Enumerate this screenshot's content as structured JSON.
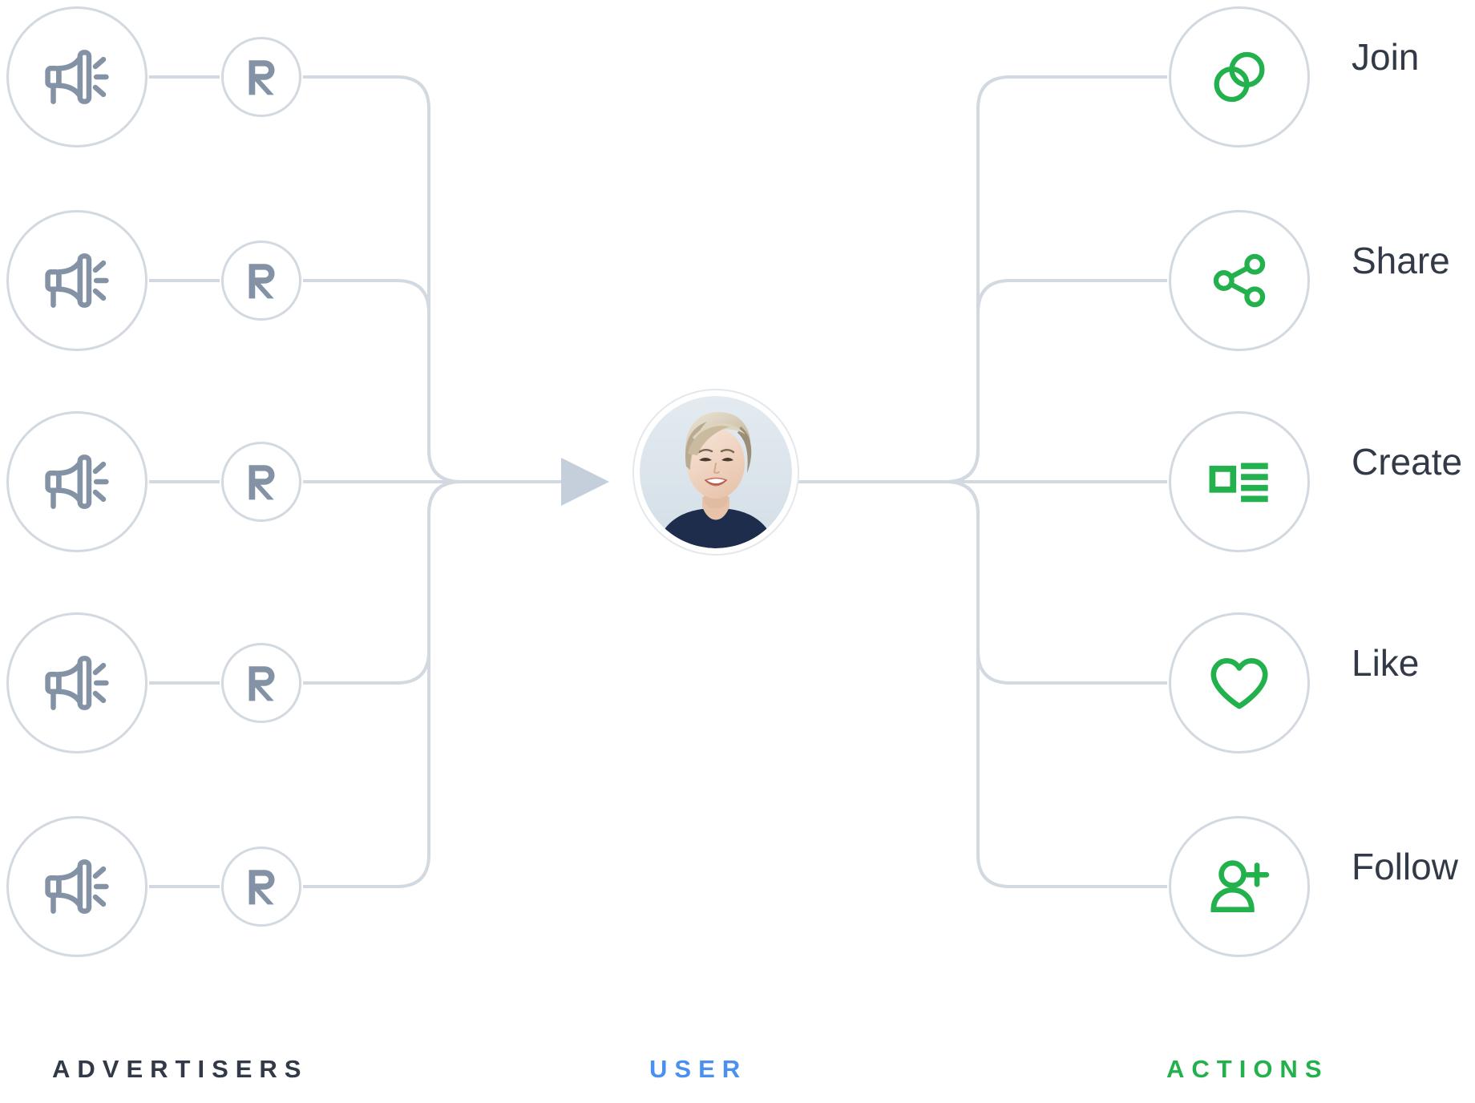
{
  "diagram": {
    "title": "Advertisers to User to Actions flow",
    "colors": {
      "line": "#d2d9e0",
      "advertiser_icon": "#8492a6",
      "brand_logo": "#8492a6",
      "action_icon": "#22b14c",
      "label_advertisers": "#323a47",
      "label_user": "#4a90f0",
      "label_actions": "#22b14c",
      "action_text": "#323a47"
    },
    "columns": {
      "advertisers_label": "ADVERTISERS",
      "user_label": "USER",
      "actions_label": "ACTIONS"
    },
    "advertisers": [
      {
        "icon": "megaphone-icon",
        "logo": "r-logo-icon"
      },
      {
        "icon": "megaphone-icon",
        "logo": "r-logo-icon"
      },
      {
        "icon": "megaphone-icon",
        "logo": "r-logo-icon"
      },
      {
        "icon": "megaphone-icon",
        "logo": "r-logo-icon"
      },
      {
        "icon": "megaphone-icon",
        "logo": "r-logo-icon"
      }
    ],
    "user": {
      "avatar_alt": "Smiling woman with short blonde hair wearing a navy top",
      "arrow": "arrow-right-icon"
    },
    "actions": [
      {
        "label": "Join",
        "icon": "overlapping-circles-icon"
      },
      {
        "label": "Share",
        "icon": "share-nodes-icon"
      },
      {
        "label": "Create",
        "icon": "content-list-icon"
      },
      {
        "label": "Like",
        "icon": "heart-icon"
      },
      {
        "label": "Follow",
        "icon": "user-plus-icon"
      }
    ]
  }
}
